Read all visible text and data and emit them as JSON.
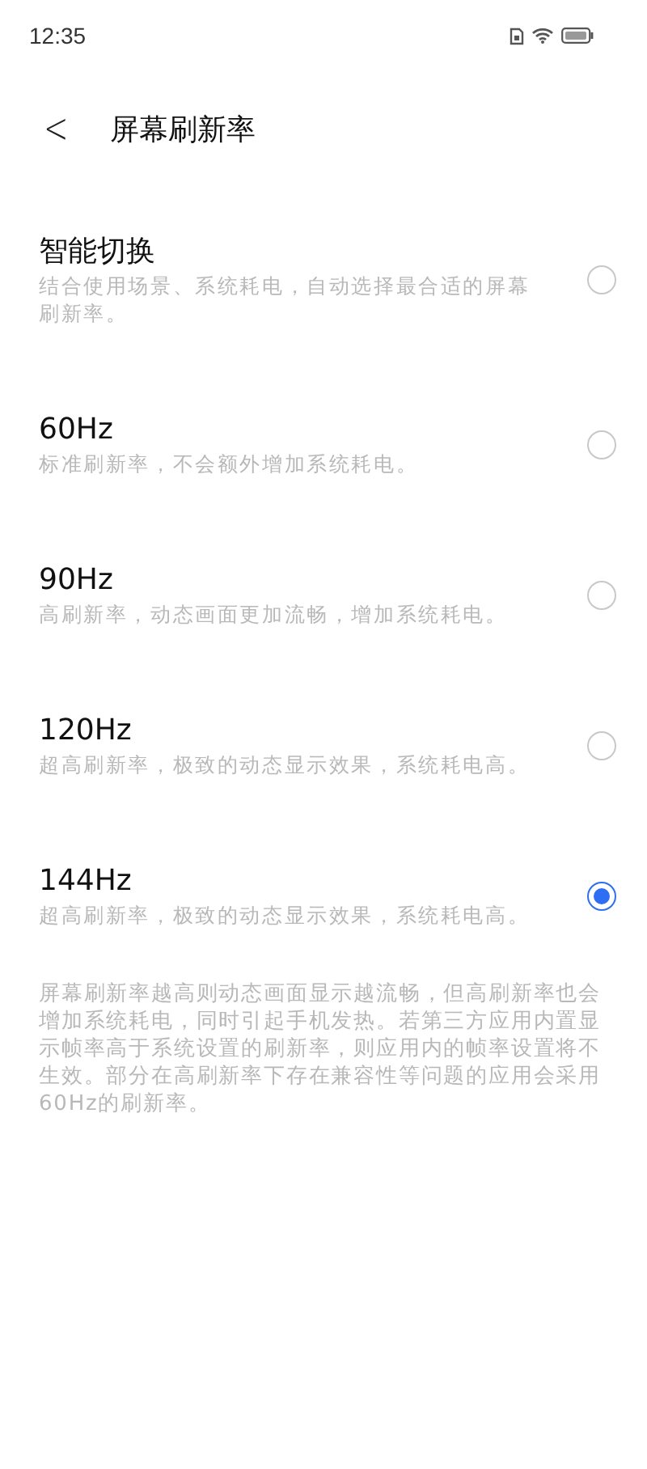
{
  "status_bar": {
    "time": "12:35"
  },
  "header": {
    "back": "<",
    "title": "屏幕刷新率"
  },
  "options": [
    {
      "title": "智能切换",
      "description": "结合使用场景、系统耗电，自动选择最合适的屏幕刷新率。",
      "selected": false
    },
    {
      "title": "60Hz",
      "description": "标准刷新率，不会额外增加系统耗电。",
      "selected": false
    },
    {
      "title": "90Hz",
      "description": "高刷新率，动态画面更加流畅，增加系统耗电。",
      "selected": false
    },
    {
      "title": "120Hz",
      "description": "超高刷新率，极致的动态显示效果，系统耗电高。",
      "selected": false
    },
    {
      "title": "144Hz",
      "description": "超高刷新率，极致的动态显示效果，系统耗电高。",
      "selected": true
    }
  ],
  "footnote": "屏幕刷新率越高则动态画面显示越流畅，但高刷新率也会增加系统耗电，同时引起手机发热。若第三方应用内置显示帧率高于系统设置的刷新率，则应用内的帧率设置将不生效。部分在高刷新率下存在兼容性等问题的应用会采用60Hz的刷新率。"
}
